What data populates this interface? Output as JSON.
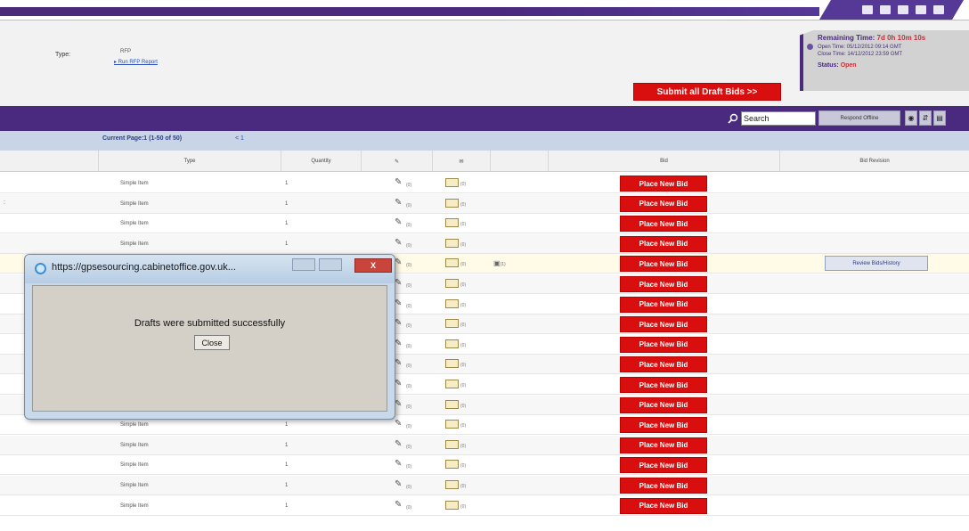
{
  "topbar": {
    "icons": [
      "pin-icon",
      "calendar-icon",
      "print-icon",
      "expand-icon",
      "help-icon"
    ]
  },
  "header": {
    "type_label": "Type:",
    "type_value": "RFP",
    "run_link": "▸ Run RFP Report",
    "submit_button": "Submit all Draft Bids >>"
  },
  "timebox": {
    "remaining_label": "Remaining Time:",
    "remaining_value": "7d 0h 10m 10s",
    "open_time": "Open Time: 05/12/2012 09:14 GMT",
    "close_time": "Close Time: 14/12/2012 23:59 GMT",
    "status_label": "Status:",
    "status_value": "Open"
  },
  "toolbar": {
    "search_value": "Search",
    "respond_offline": "Respond Offline"
  },
  "pager": {
    "current": "Current Page:1 (1-50 of 50)",
    "pages": "< 1"
  },
  "table": {
    "headers": {
      "type": "Type",
      "quantity": "Quantity",
      "bid": "Bid",
      "bid_revision": "Bid Revision"
    },
    "rows": [
      {
        "type": "Simple Item",
        "qty": "1",
        "pen_count": "(0)",
        "mail_count": "(0)",
        "bid": "Place New Bid"
      },
      {
        "type": "Simple Item",
        "qty": "1",
        "pen_count": "(0)",
        "mail_count": "(0)",
        "bid": "Place New Bid"
      },
      {
        "type": "Simple Item",
        "qty": "1",
        "pen_count": "(0)",
        "mail_count": "(0)",
        "bid": "Place New Bid"
      },
      {
        "type": "Simple Item",
        "qty": "1",
        "pen_count": "(0)",
        "mail_count": "(0)",
        "bid": "Place New Bid"
      },
      {
        "type": "",
        "qty": "",
        "pen_count": "(0)",
        "mail_count": "(0)",
        "note": "(1)",
        "bid": "Place New Bid",
        "review": "Review Bids/History"
      },
      {
        "type": "",
        "qty": "",
        "pen_count": "(0)",
        "mail_count": "(0)",
        "bid": "Place New Bid"
      },
      {
        "type": "",
        "qty": "",
        "pen_count": "(0)",
        "mail_count": "(0)",
        "bid": "Place New Bid"
      },
      {
        "type": "",
        "qty": "",
        "pen_count": "(0)",
        "mail_count": "(0)",
        "bid": "Place New Bid"
      },
      {
        "type": "",
        "qty": "",
        "pen_count": "(0)",
        "mail_count": "(0)",
        "bid": "Place New Bid"
      },
      {
        "type": "",
        "qty": "",
        "pen_count": "(0)",
        "mail_count": "(0)",
        "bid": "Place New Bid"
      },
      {
        "type": "",
        "qty": "",
        "pen_count": "(0)",
        "mail_count": "(0)",
        "bid": "Place New Bid"
      },
      {
        "type": "",
        "qty": "",
        "pen_count": "(0)",
        "mail_count": "(0)",
        "bid": "Place New Bid"
      },
      {
        "type": "Simple Item",
        "qty": "1",
        "pen_count": "(0)",
        "mail_count": "(0)",
        "bid": "Place New Bid"
      },
      {
        "type": "Simple Item",
        "qty": "1",
        "pen_count": "(0)",
        "mail_count": "(0)",
        "bid": "Place New Bid"
      },
      {
        "type": "Simple Item",
        "qty": "1",
        "pen_count": "(0)",
        "mail_count": "(0)",
        "bid": "Place New Bid"
      },
      {
        "type": "Simple Item",
        "qty": "1",
        "pen_count": "(0)",
        "mail_count": "(0)",
        "bid": "Place New Bid"
      },
      {
        "type": "Simple Item",
        "qty": "1",
        "pen_count": "(0)",
        "mail_count": "(0)",
        "bid": "Place New Bid"
      }
    ]
  },
  "dialog": {
    "url": "https://gpsesourcing.cabinetoffice.gov.uk...",
    "message": "Drafts were submitted successfully",
    "close_button": "Close",
    "close_glyph": "X"
  }
}
